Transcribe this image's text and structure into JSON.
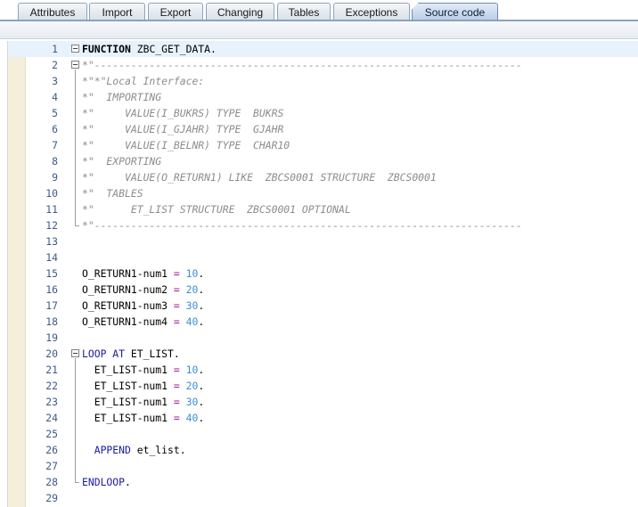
{
  "tabs": [
    {
      "label": "Attributes",
      "active": false
    },
    {
      "label": "Import",
      "active": false
    },
    {
      "label": "Export",
      "active": false
    },
    {
      "label": "Changing",
      "active": false
    },
    {
      "label": "Tables",
      "active": false
    },
    {
      "label": "Exceptions",
      "active": false
    },
    {
      "label": "Source code",
      "active": true
    }
  ],
  "editor": {
    "current_line": 1,
    "lines": [
      {
        "num": "1",
        "tokens": [
          [
            "kwb",
            "FUNCTION"
          ],
          [
            "tx",
            " ZBC_GET_DATA."
          ]
        ]
      },
      {
        "num": "2",
        "tokens": [
          [
            "cm",
            "*\"----------------------------------------------------------------------"
          ]
        ]
      },
      {
        "num": "3",
        "tokens": [
          [
            "cm",
            "*\"*\"Local Interface:"
          ]
        ]
      },
      {
        "num": "4",
        "tokens": [
          [
            "cm",
            "*\"  IMPORTING"
          ]
        ]
      },
      {
        "num": "5",
        "tokens": [
          [
            "cm",
            "*\"     VALUE(I_BUKRS) TYPE  BUKRS"
          ]
        ]
      },
      {
        "num": "6",
        "tokens": [
          [
            "cm",
            "*\"     VALUE(I_GJAHR) TYPE  GJAHR"
          ]
        ]
      },
      {
        "num": "7",
        "tokens": [
          [
            "cm",
            "*\"     VALUE(I_BELNR) TYPE  CHAR10"
          ]
        ]
      },
      {
        "num": "8",
        "tokens": [
          [
            "cm",
            "*\"  EXPORTING"
          ]
        ]
      },
      {
        "num": "9",
        "tokens": [
          [
            "cm",
            "*\"     VALUE(O_RETURN1) LIKE  ZBCS0001 STRUCTURE  ZBCS0001"
          ]
        ]
      },
      {
        "num": "10",
        "tokens": [
          [
            "cm",
            "*\"  TABLES"
          ]
        ]
      },
      {
        "num": "11",
        "tokens": [
          [
            "cm",
            "*\"      ET_LIST STRUCTURE  ZBCS0001 OPTIONAL"
          ]
        ]
      },
      {
        "num": "12",
        "tokens": [
          [
            "cm",
            "*\"----------------------------------------------------------------------"
          ]
        ]
      },
      {
        "num": "13",
        "tokens": []
      },
      {
        "num": "14",
        "tokens": []
      },
      {
        "num": "15",
        "tokens": [
          [
            "tx",
            "O_RETURN1-num1 "
          ],
          [
            "op",
            "="
          ],
          [
            "tx",
            " "
          ],
          [
            "num",
            "10"
          ],
          [
            "tx",
            "."
          ]
        ]
      },
      {
        "num": "16",
        "tokens": [
          [
            "tx",
            "O_RETURN1-num2 "
          ],
          [
            "op",
            "="
          ],
          [
            "tx",
            " "
          ],
          [
            "num",
            "20"
          ],
          [
            "tx",
            "."
          ]
        ]
      },
      {
        "num": "17",
        "tokens": [
          [
            "tx",
            "O_RETURN1-num3 "
          ],
          [
            "op",
            "="
          ],
          [
            "tx",
            " "
          ],
          [
            "num",
            "30"
          ],
          [
            "tx",
            "."
          ]
        ]
      },
      {
        "num": "18",
        "tokens": [
          [
            "tx",
            "O_RETURN1-num4 "
          ],
          [
            "op",
            "="
          ],
          [
            "tx",
            " "
          ],
          [
            "num",
            "40"
          ],
          [
            "tx",
            "."
          ]
        ]
      },
      {
        "num": "19",
        "tokens": []
      },
      {
        "num": "20",
        "tokens": [
          [
            "kw",
            "LOOP AT"
          ],
          [
            "tx",
            " ET_LIST."
          ]
        ]
      },
      {
        "num": "21",
        "tokens": [
          [
            "tx",
            "  ET_LIST-num1 "
          ],
          [
            "op",
            "="
          ],
          [
            "tx",
            " "
          ],
          [
            "num",
            "10"
          ],
          [
            "tx",
            "."
          ]
        ]
      },
      {
        "num": "22",
        "tokens": [
          [
            "tx",
            "  ET_LIST-num1 "
          ],
          [
            "op",
            "="
          ],
          [
            "tx",
            " "
          ],
          [
            "num",
            "20"
          ],
          [
            "tx",
            "."
          ]
        ]
      },
      {
        "num": "23",
        "tokens": [
          [
            "tx",
            "  ET_LIST-num1 "
          ],
          [
            "op",
            "="
          ],
          [
            "tx",
            " "
          ],
          [
            "num",
            "30"
          ],
          [
            "tx",
            "."
          ]
        ]
      },
      {
        "num": "24",
        "tokens": [
          [
            "tx",
            "  ET_LIST-num1 "
          ],
          [
            "op",
            "="
          ],
          [
            "tx",
            " "
          ],
          [
            "num",
            "40"
          ],
          [
            "tx",
            "."
          ]
        ]
      },
      {
        "num": "25",
        "tokens": []
      },
      {
        "num": "26",
        "tokens": [
          [
            "tx",
            "  "
          ],
          [
            "kw",
            "APPEND"
          ],
          [
            "tx",
            " et_list."
          ]
        ]
      },
      {
        "num": "27",
        "tokens": []
      },
      {
        "num": "28",
        "tokens": [
          [
            "kw",
            "ENDLOOP"
          ],
          [
            "tx",
            "."
          ]
        ]
      },
      {
        "num": "29",
        "tokens": []
      }
    ]
  }
}
